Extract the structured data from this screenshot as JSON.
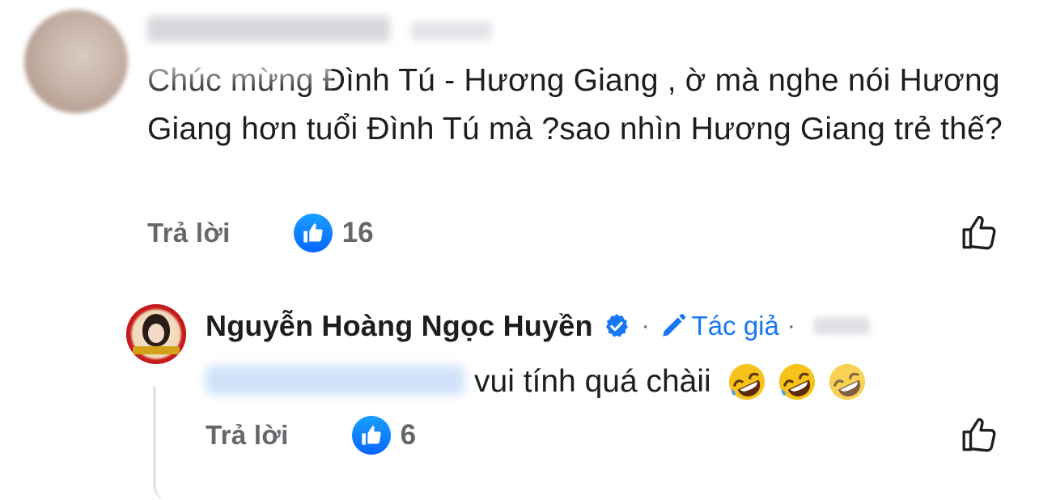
{
  "comment": {
    "text": "Chúc mừng Đình Tú - Hương Giang , ờ mà nghe nói Hương Giang hơn tuổi Đình Tú mà ?sao nhìn Hương Giang trẻ thế?",
    "reply_label": "Trả lời",
    "like_count": "16"
  },
  "reply": {
    "author": "Nguyễn Hoàng Ngọc Huyền",
    "author_tag": "Tác giả",
    "separator": "·",
    "text": "vui tính quá chàii",
    "emojis": [
      "rolling-on-floor-laughing",
      "rolling-on-floor-laughing",
      "rolling-on-floor-laughing"
    ],
    "reply_label": "Trả lời",
    "like_count": "6"
  },
  "colors": {
    "accent_blue": "#1877f2",
    "meta_gray": "#65676b",
    "text": "#1c1e21"
  }
}
